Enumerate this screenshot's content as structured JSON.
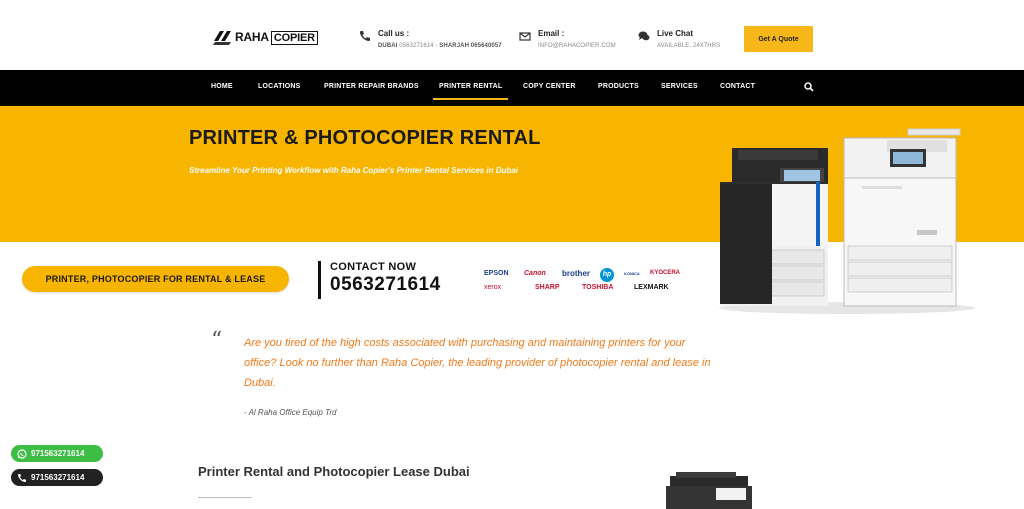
{
  "header": {
    "logo": {
      "word1": "RAHA",
      "word2": "COPIER"
    },
    "call": {
      "title": "Call us :",
      "line_prefix_1": "DUBAI",
      "number_1": "0563271614",
      "sep": " - ",
      "line_prefix_2": "SHARJAH",
      "number_2": "065640057"
    },
    "email": {
      "title": "Email :",
      "address": "INFO@RAHACOPIER.COM"
    },
    "chat": {
      "title": "Live Chat",
      "availability": "AVAILABLE. 24X7HRS"
    },
    "quote_button": "Get A Quote"
  },
  "nav": {
    "items": [
      {
        "label": "HOME"
      },
      {
        "label": "LOCATIONS"
      },
      {
        "label": "PRINTER REPAIR BRANDS"
      },
      {
        "label": "PRINTER RENTAL"
      },
      {
        "label": "COPY CENTER"
      },
      {
        "label": "PRODUCTS"
      },
      {
        "label": "SERVICES"
      },
      {
        "label": "CONTACT"
      }
    ],
    "active": "PRINTER RENTAL"
  },
  "hero": {
    "title": "PRINTER & PHOTOCOPIER RENTAL",
    "subtitle": "Streamline Your Printing Workflow with Raha Copier's Printer Rental Services in Dubai"
  },
  "banner": {
    "pill": "PRINTER, PHOTOCOPIER  FOR RENTAL & LEASE",
    "contact_label": "CONTACT NOW",
    "contact_number": "0563271614",
    "brands": [
      "EPSON",
      "Canon",
      "brother",
      "hp",
      "KONICA",
      "KYOCERA",
      "xerox",
      "SHARP",
      "TOSHIBA",
      "LEXMARK"
    ]
  },
  "quote": {
    "text": "Are you tired of the high costs associated with purchasing and maintaining printers for your office? Look no further than Raha Copier, the leading provider of  photocopier rental and lease in Dubai.",
    "author": "- Al Raha Office Equip Trd"
  },
  "section": {
    "title": "Printer Rental and Photocopier Lease Dubai"
  },
  "whatsapp": {
    "number_1": "971563271614",
    "number_2": "971563271614"
  },
  "colors": {
    "accent": "#f8b500",
    "quote": "#f07a1a",
    "whatsapp": "#3cbd44"
  }
}
